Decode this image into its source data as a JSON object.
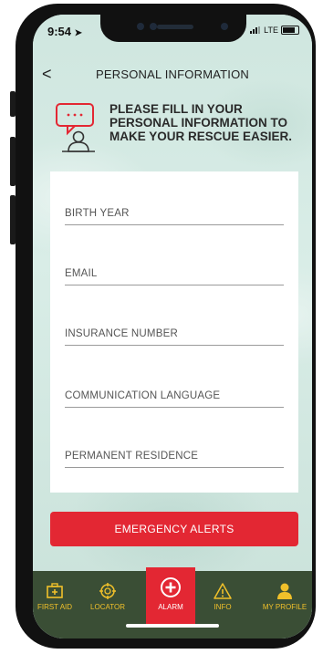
{
  "status": {
    "time": "9:54",
    "network": "LTE"
  },
  "header": {
    "back": "<",
    "title": "PERSONAL INFORMATION"
  },
  "intro": {
    "text": "PLEASE FILL IN YOUR PERSONAL INFORMATION TO MAKE YOUR RESCUE EASIER."
  },
  "form": {
    "fields": [
      {
        "placeholder": "BIRTH YEAR"
      },
      {
        "placeholder": "EMAIL"
      },
      {
        "placeholder": "INSURANCE NUMBER"
      },
      {
        "placeholder": "COMMUNICATION LANGUAGE"
      },
      {
        "placeholder": "PERMANENT RESIDENCE"
      }
    ]
  },
  "emergency_button": {
    "label": "EMERGENCY ALERTS"
  },
  "tabs": [
    {
      "label": "FIRST AID",
      "icon": "first-aid-kit-icon"
    },
    {
      "label": "LOCATOR",
      "icon": "crosshair-icon"
    },
    {
      "label": "ALARM",
      "icon": "plus-circle-icon"
    },
    {
      "label": "INFO",
      "icon": "warning-icon"
    },
    {
      "label": "MY PROFILE",
      "icon": "person-icon"
    }
  ],
  "colors": {
    "accent": "#e32733",
    "tabbar": "#3a4e35",
    "tab_icon": "#f0c02a",
    "background": "#d6ebe5"
  }
}
